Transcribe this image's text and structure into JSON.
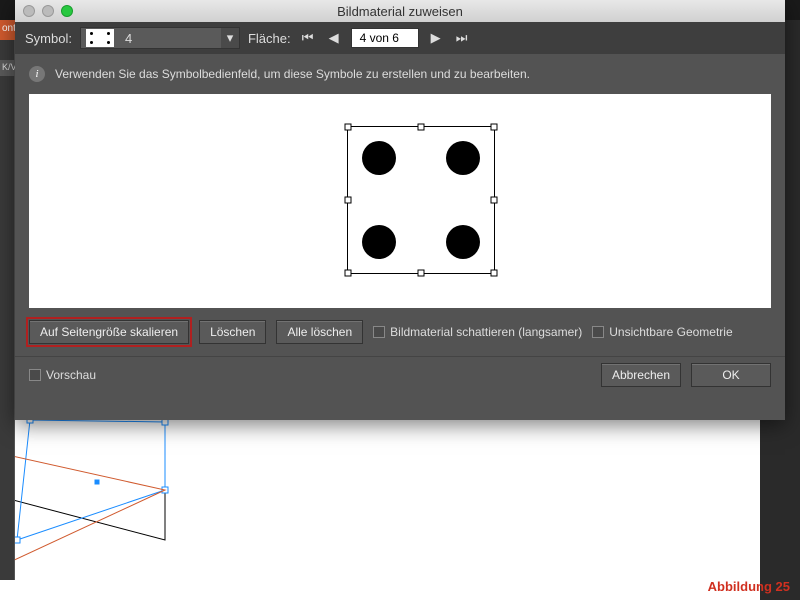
{
  "dialog": {
    "title": "Bildmaterial zuweisen",
    "symbol_label": "Symbol:",
    "symbol_value": "4",
    "flaeche_label": "Fläche:",
    "flaeche_value": "4 von 6",
    "info_text": "Verwenden Sie das Symbolbedienfeld, um diese Symbole zu erstellen und zu bearbeiten."
  },
  "buttons": {
    "scale": "Auf Seitengröße skalieren",
    "delete": "Löschen",
    "delete_all": "Alle löschen",
    "cancel": "Abbrechen",
    "ok": "OK"
  },
  "checkboxes": {
    "shade": "Bildmaterial schattieren (langsamer)",
    "invisible": "Unsichtbare Geometrie",
    "preview": "Vorschau"
  },
  "caption": "Abbildung 25",
  "bg": {
    "tab1": "ontu",
    "tab2": "K/V"
  }
}
